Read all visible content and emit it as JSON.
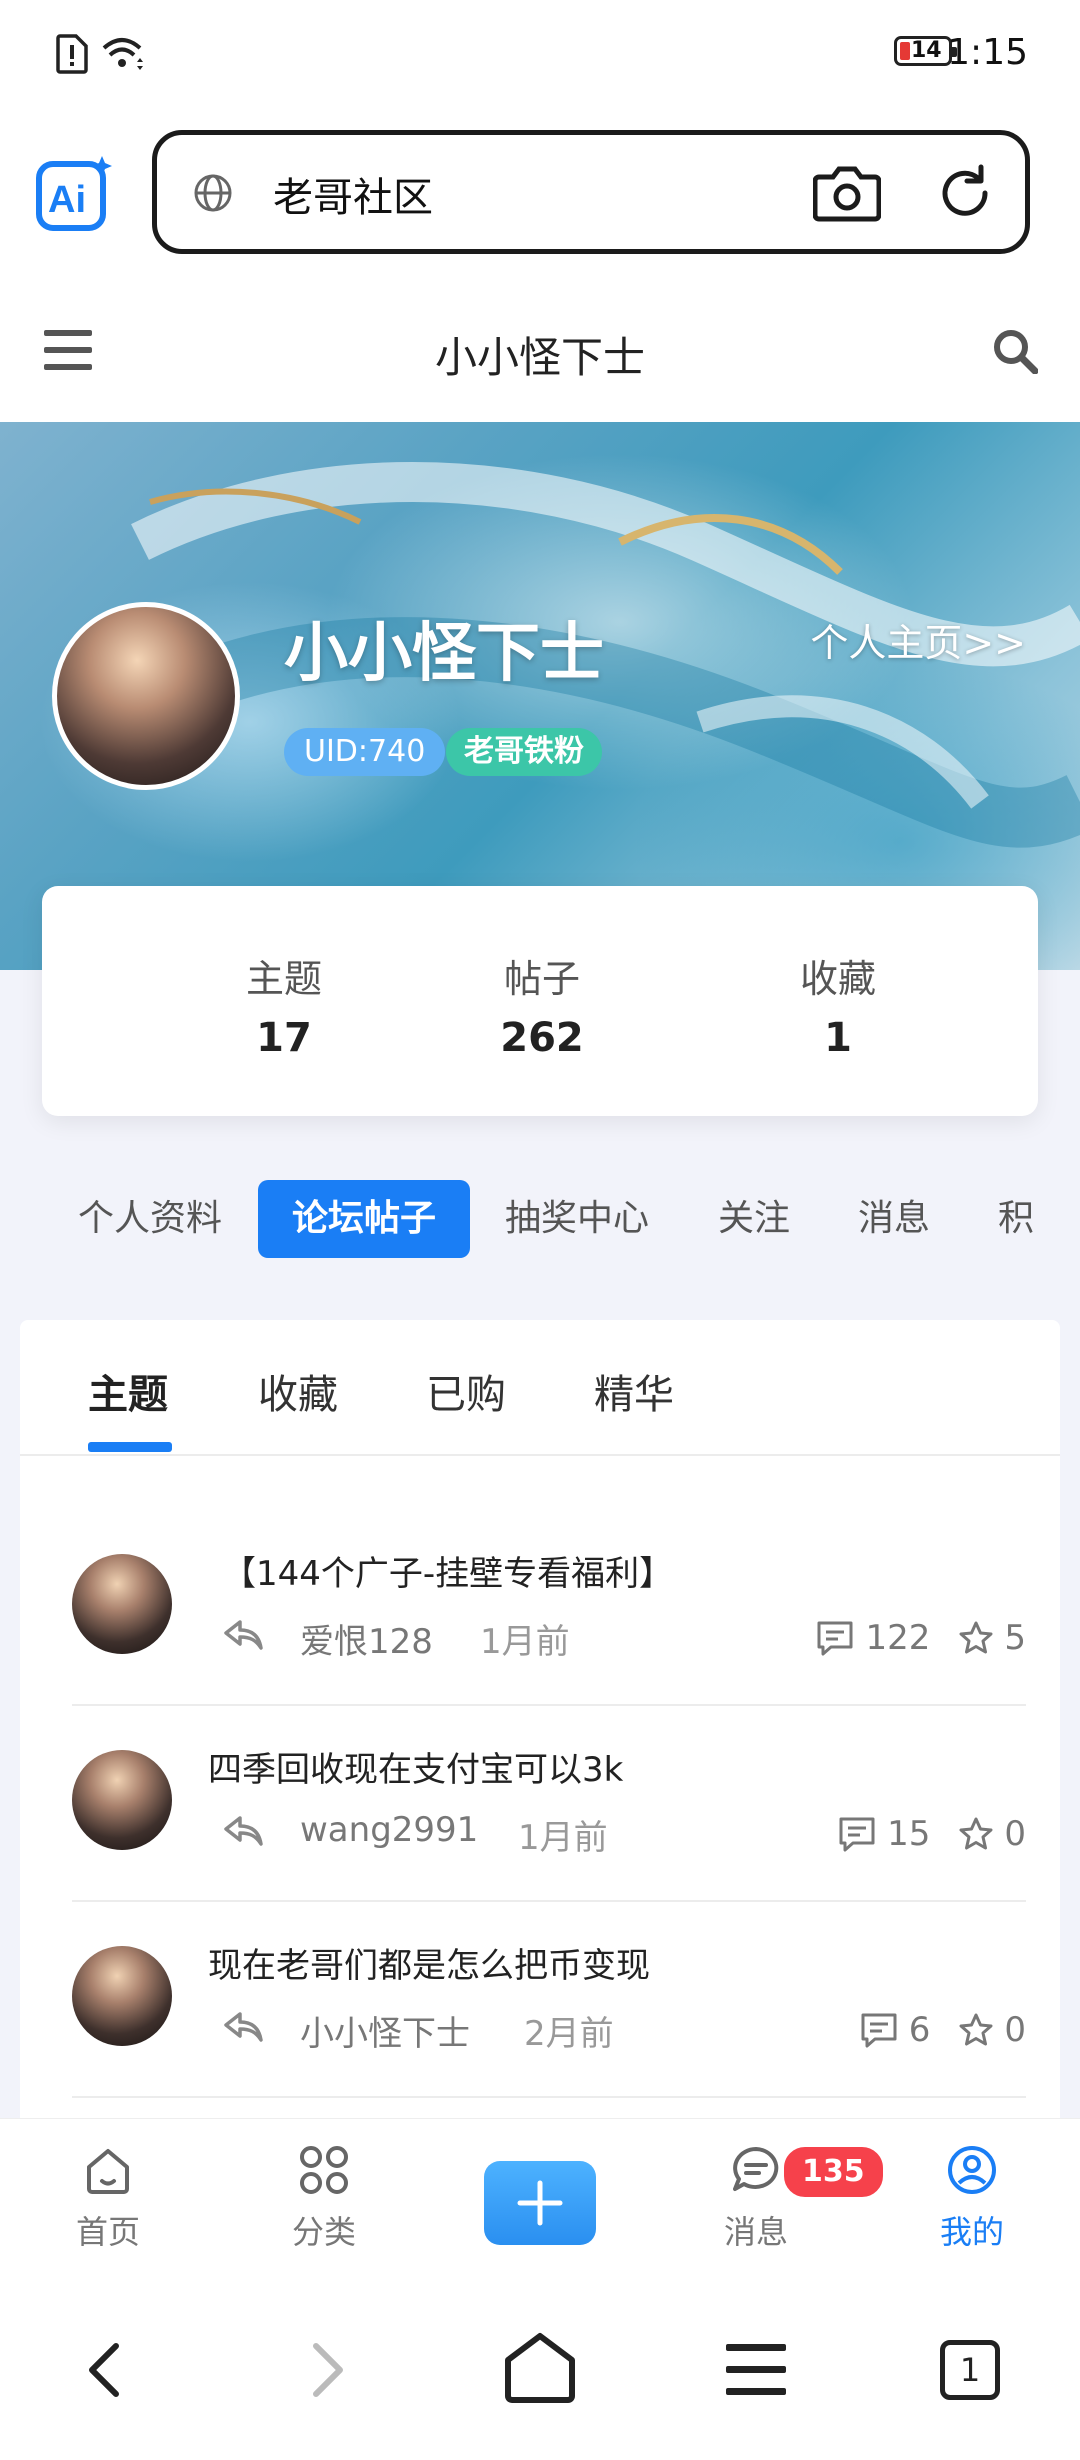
{
  "status_bar": {
    "time": "1:15",
    "battery": "14"
  },
  "browser": {
    "url_text": "老哥社区"
  },
  "site_header": {
    "title": "小小怪下士"
  },
  "profile": {
    "name": "小小怪下士",
    "homepage_link": "个人主页>>",
    "uid": "UID:740",
    "badge": "老哥铁粉"
  },
  "stats": [
    {
      "label": "主题",
      "value": "17"
    },
    {
      "label": "帖子",
      "value": "262"
    },
    {
      "label": "收藏",
      "value": "1"
    }
  ],
  "profile_tabs": [
    "个人资料",
    "论坛帖子",
    "抽奖中心",
    "关注",
    "消息",
    "积"
  ],
  "sub_tabs": [
    "主题",
    "收藏",
    "已购",
    "精华"
  ],
  "posts": [
    {
      "title": "【144个广子-挂壁专看福利】",
      "author": "爱恨128",
      "time": "1月前",
      "comments": "122",
      "stars": "5"
    },
    {
      "title": "四季回收现在支付宝可以3k",
      "author": "wang2991",
      "time": "1月前",
      "comments": "15",
      "stars": "0"
    },
    {
      "title": "现在老哥们都是怎么把币变现",
      "author": "小小怪下士",
      "time": "2月前",
      "comments": "6",
      "stars": "0"
    }
  ],
  "bottom_nav": {
    "home": "首页",
    "category": "分类",
    "messages": "消息",
    "message_badge": "135",
    "mine": "我的"
  },
  "system_nav": {
    "tab_count": "1"
  },
  "colors": {
    "accent": "#1a7ef5",
    "badge_red": "#f6414b",
    "fan_badge": "#3cc6a8",
    "uid_badge": "#5fb0f3"
  }
}
